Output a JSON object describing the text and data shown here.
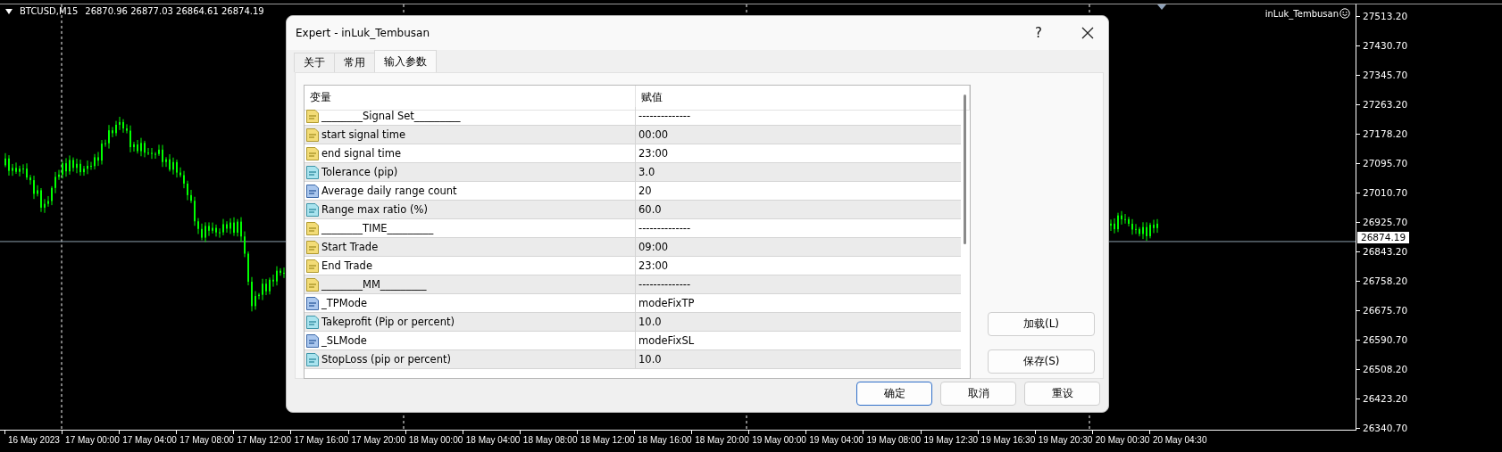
{
  "chart": {
    "symbol": "BTCUSD,M15",
    "quote": "26870.96 26877.03 26864.61 26874.19",
    "indicator": "inLuk_Tembusan",
    "price_labels": [
      "27513.20",
      "27430.70",
      "27345.70",
      "27263.20",
      "27178.20",
      "27095.70",
      "27010.70",
      "26925.70",
      "26843.20",
      "26758.20",
      "26675.70",
      "26590.70",
      "26508.20",
      "26423.20",
      "26340.70"
    ],
    "current_price": "26874.19",
    "time_labels": [
      "16 May 2023",
      "17 May 00:00",
      "17 May 04:00",
      "17 May 08:00",
      "17 May 12:00",
      "17 May 16:00",
      "17 May 20:00",
      "18 May 00:00",
      "18 May 04:00",
      "18 May 08:00",
      "18 May 12:00",
      "18 May 16:00",
      "18 May 20:00",
      "19 May 00:00",
      "19 May 04:00",
      "19 May 08:00",
      "19 May 12:30",
      "19 May 16:30",
      "19 May 20:30",
      "20 May 00:30",
      "20 May 04:30"
    ]
  },
  "dialog": {
    "title": "Expert - inLuk_Tembusan",
    "help": "?",
    "tabs": [
      {
        "label": "关于",
        "selected": false
      },
      {
        "label": "常用",
        "selected": false
      },
      {
        "label": "输入参数",
        "selected": true
      }
    ],
    "table": {
      "columns": [
        "变量",
        "赋值"
      ],
      "rows": [
        {
          "kind": "string",
          "name": "________Signal Set_________",
          "value": "--------------"
        },
        {
          "kind": "string",
          "name": "start signal time",
          "value": "00:00"
        },
        {
          "kind": "string",
          "name": "end signal time",
          "value": "23:00"
        },
        {
          "kind": "double",
          "name": "Tolerance (pip)",
          "value": "3.0"
        },
        {
          "kind": "int",
          "name": "Average daily range count",
          "value": "20"
        },
        {
          "kind": "double",
          "name": "Range max ratio (%)",
          "value": "60.0"
        },
        {
          "kind": "string",
          "name": "________TIME_________",
          "value": "--------------"
        },
        {
          "kind": "string",
          "name": "Start Trade",
          "value": "09:00"
        },
        {
          "kind": "string",
          "name": "End Trade",
          "value": "23:00"
        },
        {
          "kind": "string",
          "name": "________MM_________",
          "value": "--------------"
        },
        {
          "kind": "int",
          "name": "_TPMode",
          "value": "modeFixTP"
        },
        {
          "kind": "double",
          "name": "Takeprofit (Pip or percent)",
          "value": "10.0"
        },
        {
          "kind": "int",
          "name": "_SLMode",
          "value": "modeFixSL"
        },
        {
          "kind": "double",
          "name": "StopLoss (pip or percent)",
          "value": "10.0"
        }
      ]
    },
    "side_buttons": [
      "加载(L)",
      "保存(S)"
    ],
    "buttons": [
      {
        "label": "确定",
        "default": true
      },
      {
        "label": "取消",
        "default": false
      },
      {
        "label": "重设",
        "default": false
      }
    ]
  }
}
